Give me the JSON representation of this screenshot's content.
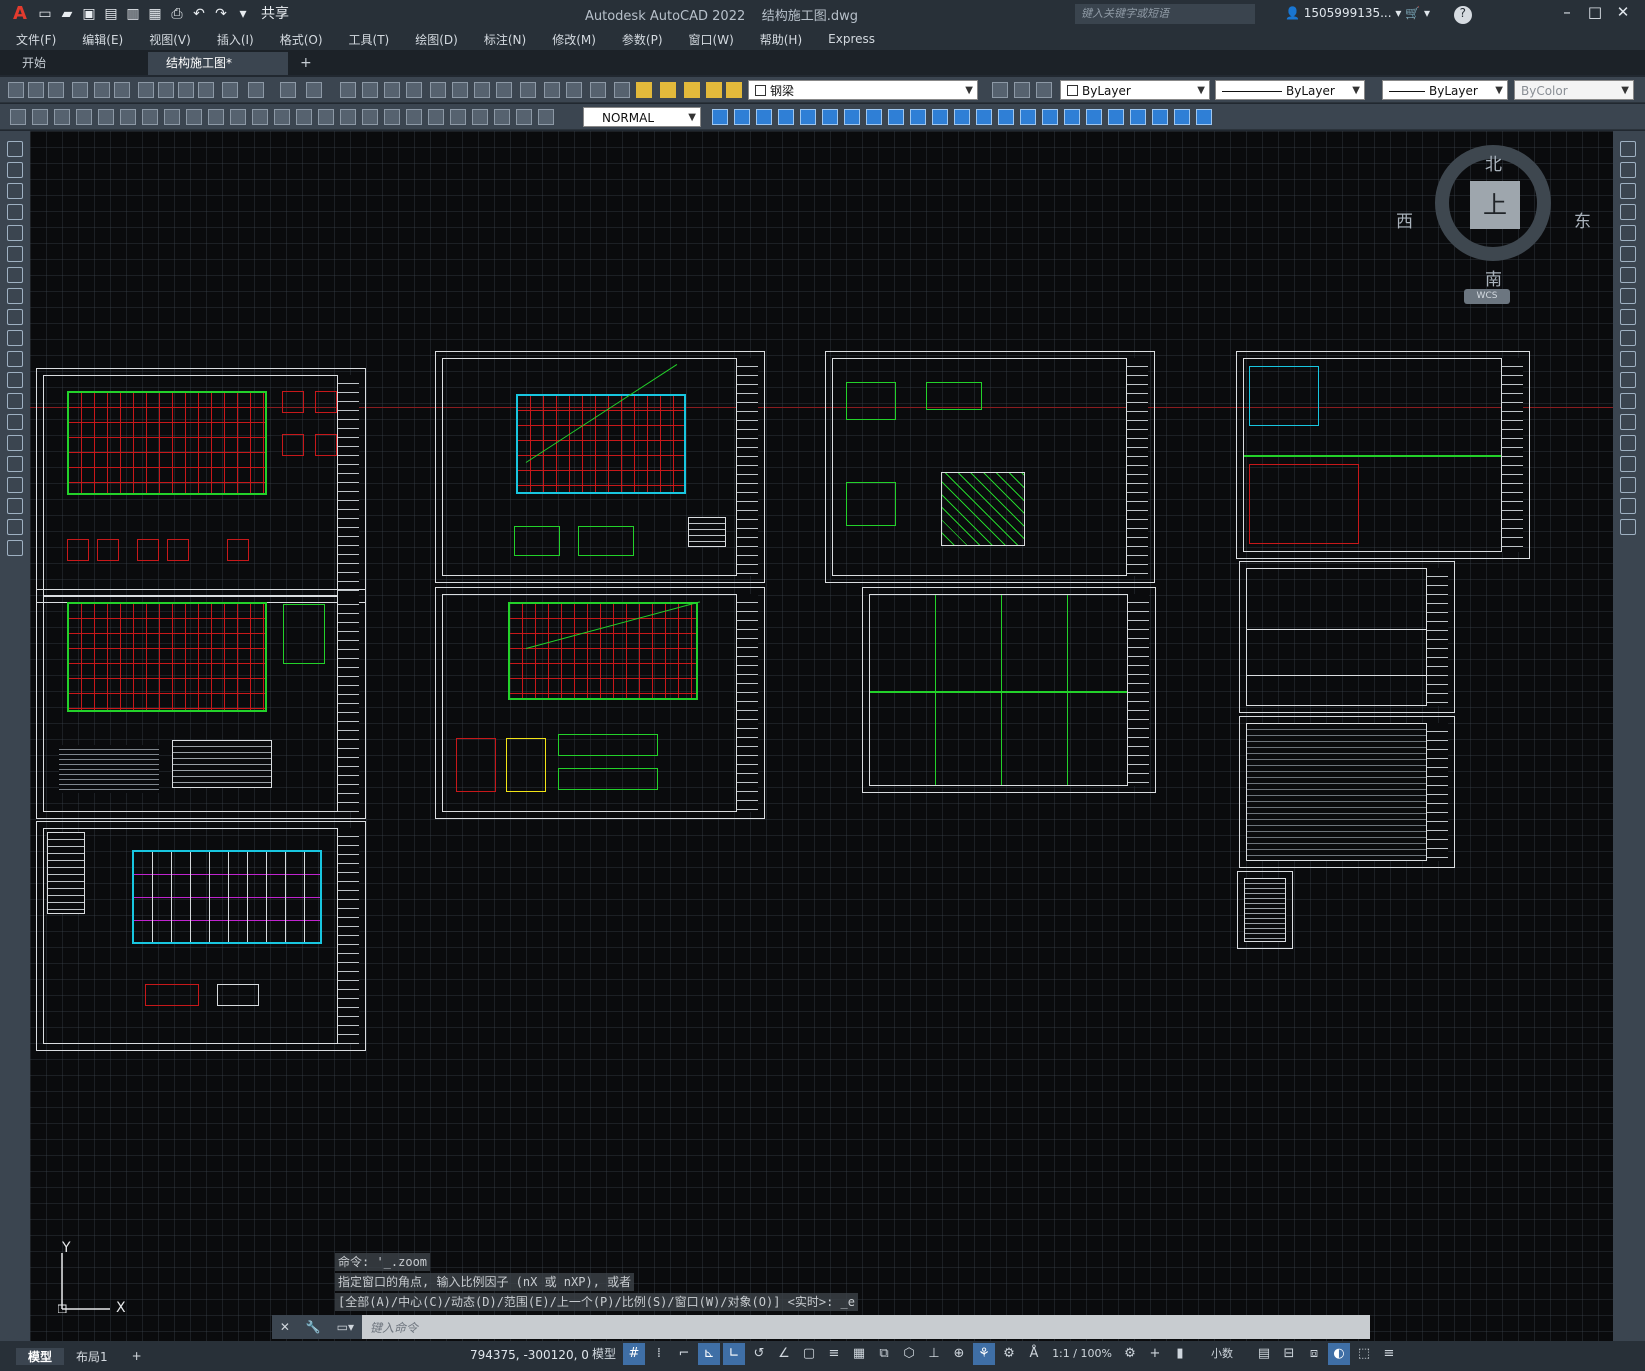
{
  "app": {
    "title": "Autodesk AutoCAD 2022    结构施工图.dwg",
    "share_label": "共享",
    "search_placeholder": "键入关键字或短语",
    "user": "1505999135...",
    "help": "?"
  },
  "menu": [
    "文件(F)",
    "编辑(E)",
    "视图(V)",
    "插入(I)",
    "格式(O)",
    "工具(T)",
    "绘图(D)",
    "标注(N)",
    "修改(M)",
    "参数(P)",
    "窗口(W)",
    "帮助(H)",
    "Express"
  ],
  "tabs": {
    "start": "开始",
    "drawing": "结构施工图*",
    "add": "+"
  },
  "toolbar": {
    "layer": "钢梁",
    "color": "ByLayer",
    "linetype": "ByLayer",
    "lineweight": "ByLayer",
    "plotstyle": "ByColor",
    "dimstyle": "NORMAL"
  },
  "viewcube": {
    "north": "北",
    "south": "南",
    "east": "东",
    "west": "西",
    "face": "上",
    "wcs": "WCS"
  },
  "command": {
    "history": [
      "命令: '_.zoom",
      "指定窗口的角点, 输入比例因子 (nX 或 nXP), 或者",
      "[全部(A)/中心(C)/动态(D)/范围(E)/上一个(P)/比例(S)/窗口(W)/对象(O)] <实时>: _e"
    ],
    "placeholder": "键入命令"
  },
  "status": {
    "model_tab": "模型",
    "layout_tab": "布局1",
    "add": "+",
    "coords": "794375, -300120, 0",
    "mode": "模型",
    "scale": "1:1 / 100%",
    "units": "小数"
  },
  "ucs": {
    "y": "Y",
    "x": "X"
  },
  "colors": {
    "accent": "#3f6fa6",
    "grid_red": "#c7181a",
    "green": "#23d12a",
    "cyan": "#18c6e0"
  }
}
